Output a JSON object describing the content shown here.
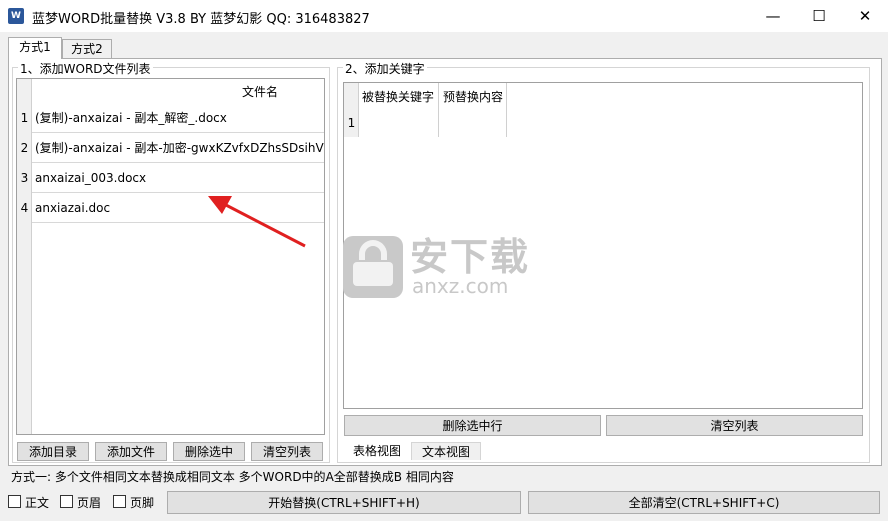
{
  "window": {
    "title": "蓝梦WORD批量替换 V3.8 BY 蓝梦幻影 QQ: 316483827",
    "app_icon_letter": "W",
    "minimize_glyph": "—",
    "maximize_glyph": "☐",
    "close_glyph": "✕"
  },
  "tabs": [
    {
      "label": "方式1"
    },
    {
      "label": "方式2"
    }
  ],
  "file_list": {
    "group_label": "1、添加WORD文件列表",
    "column_header": "文件名",
    "rows": [
      {
        "num": "1",
        "name": "(复制)-anxaizai - 副本_解密_.docx"
      },
      {
        "num": "2",
        "name": "(复制)-anxaizai - 副本-加密-gwxKZvfxDZhsSDsihVOl"
      },
      {
        "num": "3",
        "name": "anxaizai_003.docx"
      },
      {
        "num": "4",
        "name": "anxiazai.doc"
      }
    ],
    "buttons": {
      "add_dir": "添加目录",
      "add_file": "添加文件",
      "delete_selected": "删除选中",
      "clear_list": "清空列表"
    }
  },
  "keywords": {
    "group_label": "2、添加关键字",
    "col_find": "被替换关键字",
    "col_replace": "预替换内容",
    "rows": [
      {
        "num": "1",
        "find": "",
        "replace": ""
      }
    ],
    "buttons": {
      "delete_row": "删除选中行",
      "clear_list": "清空列表"
    },
    "view_tabs": [
      {
        "label": "表格视图"
      },
      {
        "label": "文本视图"
      }
    ]
  },
  "watermark": {
    "text": "安下载",
    "url": "anxz.com"
  },
  "status_text": "方式一: 多个文件相同文本替换成相同文本   多个WORD中的A全部替换成B 相同内容",
  "options": {
    "body_label": "正文",
    "header_label": "页眉",
    "footer_label": "页脚"
  },
  "actions": {
    "start": "开始替换(CTRL+SHIFT+H)",
    "clear_all": "全部清空(CTRL+SHIFT+C)"
  },
  "colors": {
    "arrow": "#e02020",
    "word_blue": "#2b579a"
  }
}
